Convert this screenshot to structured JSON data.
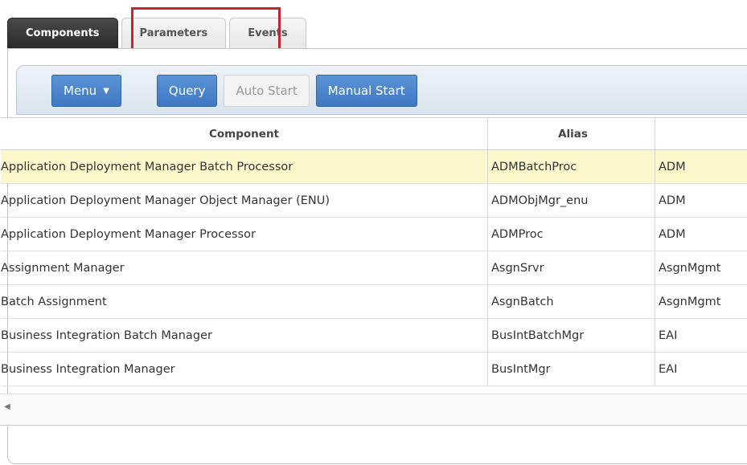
{
  "tabs": [
    {
      "label": "Components",
      "active": true
    },
    {
      "label": "Parameters",
      "active": false
    },
    {
      "label": "Events",
      "active": false
    }
  ],
  "toolbar": {
    "menu_label": "Menu",
    "query_label": "Query",
    "auto_start_label": "Auto Start",
    "manual_start_label": "Manual Start"
  },
  "table": {
    "headers": [
      "Component",
      "Alias",
      ""
    ],
    "rows": [
      [
        "Application Deployment Manager Batch Processor",
        "ADMBatchProc",
        "ADM"
      ],
      [
        "Application Deployment Manager Object Manager (ENU)",
        "ADMObjMgr_enu",
        "ADM"
      ],
      [
        "Application Deployment Manager Processor",
        "ADMProc",
        "ADM"
      ],
      [
        "Assignment Manager",
        "AsgnSrvr",
        "AsgnMgmt"
      ],
      [
        "Batch Assignment",
        "AsgnBatch",
        "AsgnMgmt"
      ],
      [
        "Business Integration Batch Manager",
        "BusIntBatchMgr",
        "EAI"
      ],
      [
        "Business Integration Manager",
        "BusIntMgr",
        "EAI"
      ]
    ]
  },
  "icons": {
    "menu_caret": "caret-down-icon",
    "scroll_left": "scroll-left-arrow-icon"
  },
  "colors": {
    "active_tab": "#2a2a2a",
    "button_blue": "#4a84cc",
    "highlight_red": "#c0282f",
    "selected_row": "#fcf8cc"
  }
}
